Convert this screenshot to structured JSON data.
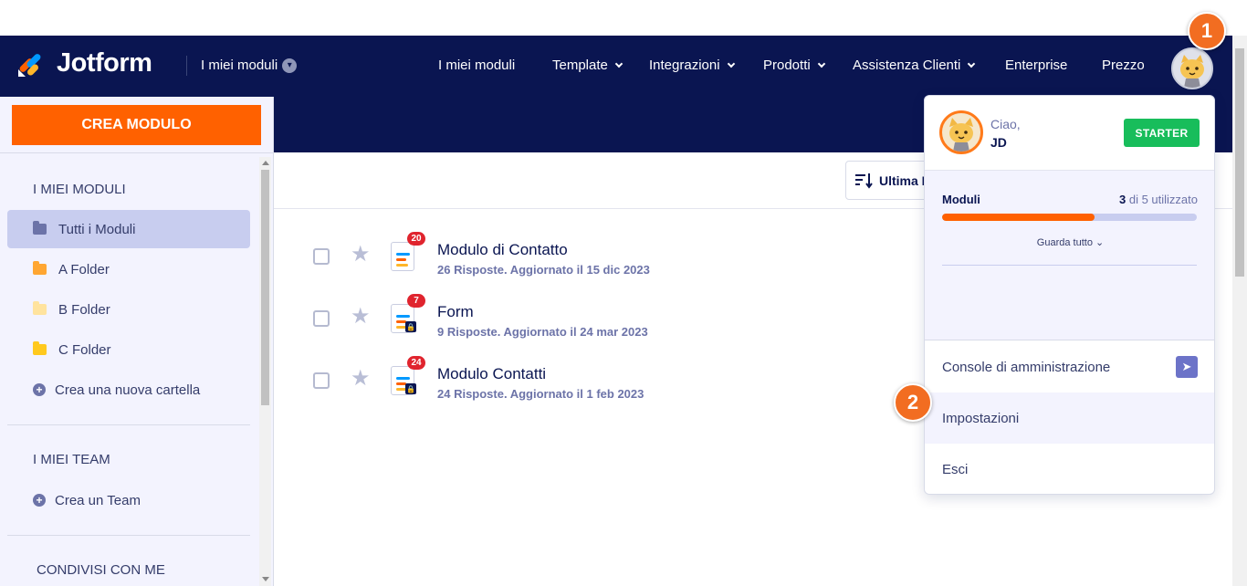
{
  "app": {
    "logo_text": "Jotform",
    "logo_colors": [
      "#ff6100",
      "#0099ff",
      "#ffb629",
      "#0a1551"
    ]
  },
  "header": {
    "my_forms_label": "I miei moduli",
    "nav": [
      {
        "label": "I miei moduli",
        "dropdown": false
      },
      {
        "label": "Template",
        "dropdown": true
      },
      {
        "label": "Integrazioni",
        "dropdown": true
      },
      {
        "label": "Prodotti",
        "dropdown": true
      },
      {
        "label": "Assistenza Clienti",
        "dropdown": true
      },
      {
        "label": "Enterprise",
        "dropdown": false
      },
      {
        "label": "Prezzo",
        "dropdown": false
      }
    ],
    "avatar_icon": "cat-avatar-icon"
  },
  "markers": {
    "one": "1",
    "two": "2",
    "color": "#f26d21"
  },
  "sidebar": {
    "create_button": "CREA MODULO",
    "my_forms_heading": "I MIEI MODULI",
    "folders": [
      {
        "label": "Tutti i Moduli",
        "color": "#6c73a8",
        "active": true
      },
      {
        "label": "A Folder",
        "color": "#ffa632",
        "active": false
      },
      {
        "label": "B Folder",
        "color": "#ffe39e",
        "active": false
      },
      {
        "label": "C Folder",
        "color": "#ffc91e",
        "active": false
      }
    ],
    "new_folder": "Crea una nuova cartella",
    "teams_heading": "I MIEI TEAM",
    "new_team": "Crea un Team",
    "shared_heading": "CONDIVISI CON ME"
  },
  "toolbar": {
    "sort_label": "Ultima M"
  },
  "forms": [
    {
      "title": "Modulo di Contatto",
      "subtitle": "26 Risposte. Aggiornato il 15 dic 2023",
      "badge": "20",
      "locked": false
    },
    {
      "title": "Form",
      "subtitle": "9 Risposte. Aggiornato il 24 mar 2023",
      "badge": "7",
      "locked": true
    },
    {
      "title": "Modulo Contatti",
      "subtitle": "24 Risposte. Aggiornato il 1 feb 2023",
      "badge": "24",
      "locked": true
    }
  ],
  "account_menu": {
    "greeting": "Ciao,",
    "name": "JD",
    "plan": "STARTER",
    "usage_label": "Moduli",
    "usage_used": "3",
    "usage_rest": " di 5 utilizzato",
    "usage_fraction": 0.6,
    "see_all": "Guarda tutto",
    "items": [
      {
        "label": "Console di amministrazione",
        "icon": "rocket-icon"
      },
      {
        "label": "Impostazioni"
      },
      {
        "label": "Esci"
      }
    ]
  }
}
